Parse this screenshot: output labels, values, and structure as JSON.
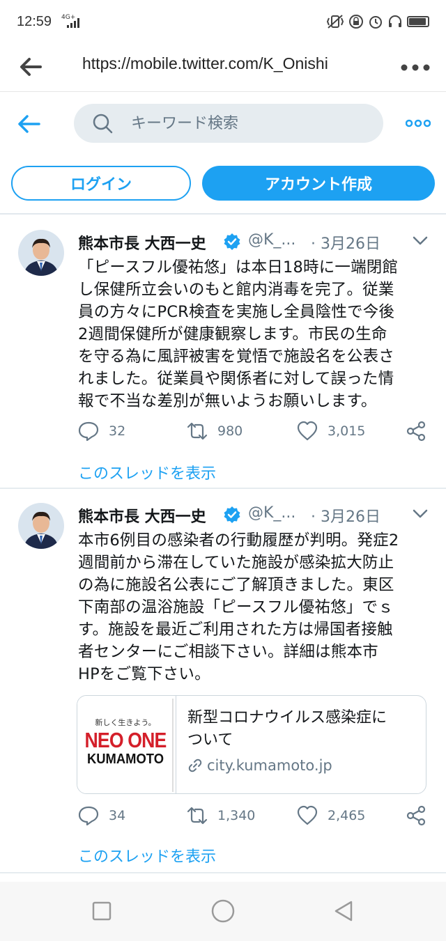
{
  "status_bar": {
    "time": "12:59",
    "network": "4G+",
    "battery_level": 0.85
  },
  "browser": {
    "url": "https://mobile.twitter.com/K_Onishi"
  },
  "header": {
    "search_placeholder": "キーワード検索",
    "login_label": "ログイン",
    "signup_label": "アカウント作成",
    "accent_color": "#1da1f2"
  },
  "tweets": [
    {
      "author": "熊本市長 大西一史",
      "handle": "@K_...",
      "date": "· 3月26日",
      "text": "「ピースフル優祐悠」は本日18時に一端閉館\nし保健所立会いのもと館内消毒を完了。従業\n員の方々にPCR検査を実施し全員陰性で今後\n2週間保健所が健康観察します。市民の生命\nを守る為に風評被害を覚悟で施設名を公表さ\nれました。従業員や関係者に対して誤った情\n報で不当な差別が無いようお願いします。",
      "replies": "32",
      "retweets": "980",
      "likes": "3,015",
      "thread_link": "このスレッドを表示"
    },
    {
      "author": "熊本市長 大西一史",
      "handle": "@K_...",
      "date": "· 3月26日",
      "text": "本市6例目の感染者の行動履歴が判明。発症2\n週間前から滞在していた施設が感染拡大防止\nの為に施設名公表にご了解頂きました。東区\n下南部の温浴施設「ピースフル優祐悠」でｓ\nす。施設を最近ご利用された方は帰国者接触\n者センターにご相談下さい。詳細は熊本市\nHPをご覧下さい。",
      "card": {
        "logo_tagline": "新しく生きよう。",
        "logo_line1": "NEO ONE",
        "logo_line2": "KUMAMOTO",
        "title": "新型コロナウイルス感染症に\nついて",
        "domain": "city.kumamoto.jp"
      },
      "replies": "34",
      "retweets": "1,340",
      "likes": "2,465",
      "thread_link": "このスレッドを表示"
    }
  ]
}
